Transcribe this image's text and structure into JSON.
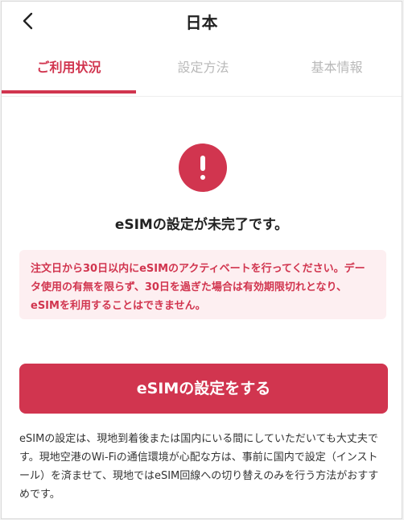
{
  "header": {
    "title": "日本",
    "back_icon": "chevron-left-icon"
  },
  "tabs": [
    {
      "label": "ご利用状況",
      "active": true
    },
    {
      "label": "設定方法",
      "active": false
    },
    {
      "label": "基本情報",
      "active": false
    }
  ],
  "status": {
    "icon": "exclamation-circle-icon",
    "title": "eSIMの設定が未完了です。"
  },
  "warning": {
    "text": "注文日から30日以内にeSIMのアクティベートを行ってください。データ使用の有無を限らず、30日を過ぎた場合は有効期限切れとなり、eSIMを利用することはできません。"
  },
  "setup_button": {
    "label": "eSIMの設定をする"
  },
  "note": {
    "text": "eSIMの設定は、現地到着後または国内にいる間にしていただいても大丈夫です。現地空港のWi-Fiの通信環境が心配な方は、事前に国内で設定（インストール）を済ませて、現地ではeSIM回線への切り替えのみを行う方法がおすすめです。"
  },
  "colors": {
    "accent": "#d1354f",
    "warning_bg": "#fdeff1",
    "inactive_tab": "#b9b9b9"
  }
}
